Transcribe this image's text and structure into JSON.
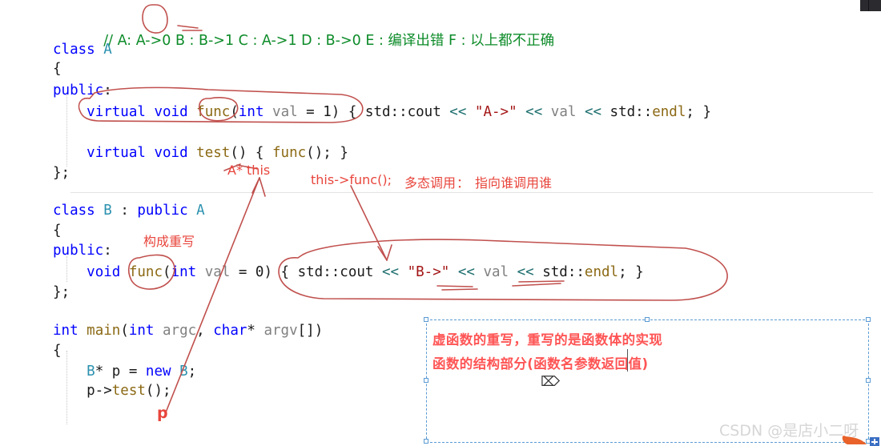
{
  "editor": {
    "language": "cpp",
    "comment_line": {
      "prefix": "// ",
      "text": "A: A->0 B : B->1 C : A->1 D : B->0 E : 编译出错 F : 以上都不正确"
    },
    "code_lines": [
      {
        "id": "l1",
        "text": "// A: A->0 B : B->1 C : A->1 D : B->0 E : 编译出错 F : 以上都不正确"
      },
      {
        "id": "l2",
        "text": "class A"
      },
      {
        "id": "l3",
        "text": "{"
      },
      {
        "id": "l4",
        "text": "public:"
      },
      {
        "id": "l5",
        "text": "    virtual void func(int val = 1) { std::cout << \"A->\" << val << std::endl; }"
      },
      {
        "id": "l6",
        "text": ""
      },
      {
        "id": "l7",
        "text": "    virtual void test() { func(); }"
      },
      {
        "id": "l8",
        "text": "};"
      },
      {
        "id": "l9",
        "text": ""
      },
      {
        "id": "l10",
        "text": "class B : public A"
      },
      {
        "id": "l11",
        "text": "{"
      },
      {
        "id": "l12",
        "text": "public:"
      },
      {
        "id": "l13",
        "text": "    void func(int val = 0) { std::cout << \"B->\" << val << std::endl; }"
      },
      {
        "id": "l14",
        "text": "};"
      },
      {
        "id": "l15",
        "text": ""
      },
      {
        "id": "l16",
        "text": "int main(int argc, char* argv[])"
      },
      {
        "id": "l17",
        "text": "{"
      },
      {
        "id": "l18",
        "text": "    B* p = new B;"
      },
      {
        "id": "l19",
        "text": "    p->test();"
      }
    ]
  },
  "annotations": {
    "a_star_this": "A* this",
    "this_func_call": "this->func();",
    "polymorphic_call": "多态调用",
    "colon": "：",
    "points_to_whom": "指向谁调用谁",
    "constitutes_override": "构成重写",
    "pointer_p": "p"
  },
  "textbox": {
    "line1": "虚函数的重写，重写的是函数体的实现",
    "line2": "函数的结构部分(函数名参数返回值)"
  },
  "watermark": {
    "text": "CSDN @是店小二呀"
  },
  "colors": {
    "keyword": "#0000ff",
    "type": "#2b91af",
    "function": "#8b6914",
    "variable": "#808080",
    "string": "#a31515",
    "operator": "#1f6f6f",
    "comment": "#0c8b28",
    "annotation_red": "#e8453c",
    "textbox_red": "#ff5555",
    "selection_blue": "#5b9bd5",
    "watermark_gray": "#d6d6d6"
  }
}
